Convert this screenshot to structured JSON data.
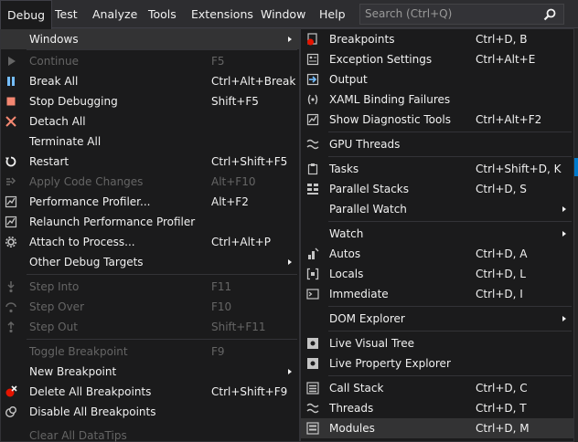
{
  "menubar": {
    "items": [
      "Debug",
      "Test",
      "Analyze",
      "Tools",
      "Extensions",
      "Window",
      "Help"
    ],
    "search_placeholder": "Search (Ctrl+Q)"
  },
  "debug_menu": {
    "items": [
      {
        "label": "Windows",
        "shortcut": "",
        "submenu": true,
        "disabled": false
      },
      {
        "label": "Continue",
        "shortcut": "F5",
        "disabled": true
      },
      {
        "label": "Break All",
        "shortcut": "Ctrl+Alt+Break",
        "disabled": false
      },
      {
        "label": "Stop Debugging",
        "shortcut": "Shift+F5",
        "disabled": false
      },
      {
        "label": "Detach All",
        "shortcut": "",
        "disabled": false
      },
      {
        "label": "Terminate All",
        "shortcut": "",
        "disabled": false
      },
      {
        "label": "Restart",
        "shortcut": "Ctrl+Shift+F5",
        "disabled": false
      },
      {
        "label": "Apply Code Changes",
        "shortcut": "Alt+F10",
        "disabled": true
      },
      {
        "label": "Performance Profiler...",
        "shortcut": "Alt+F2",
        "disabled": false
      },
      {
        "label": "Relaunch Performance Profiler",
        "shortcut": "",
        "disabled": false
      },
      {
        "label": "Attach to Process...",
        "shortcut": "Ctrl+Alt+P",
        "disabled": false
      },
      {
        "label": "Other Debug Targets",
        "shortcut": "",
        "submenu": true,
        "disabled": false
      },
      {
        "label": "Step Into",
        "shortcut": "F11",
        "disabled": true
      },
      {
        "label": "Step Over",
        "shortcut": "F10",
        "disabled": true
      },
      {
        "label": "Step Out",
        "shortcut": "Shift+F11",
        "disabled": true
      },
      {
        "label": "Toggle Breakpoint",
        "shortcut": "F9",
        "disabled": true
      },
      {
        "label": "New Breakpoint",
        "shortcut": "",
        "submenu": true,
        "disabled": false
      },
      {
        "label": "Delete All Breakpoints",
        "shortcut": "Ctrl+Shift+F9",
        "disabled": false
      },
      {
        "label": "Disable All Breakpoints",
        "shortcut": "",
        "disabled": false
      },
      {
        "label": "Clear All DataTips",
        "shortcut": "",
        "disabled": true
      }
    ]
  },
  "windows_submenu": {
    "items": [
      {
        "label": "Breakpoints",
        "shortcut": "Ctrl+D, B"
      },
      {
        "label": "Exception Settings",
        "shortcut": "Ctrl+Alt+E"
      },
      {
        "label": "Output",
        "shortcut": ""
      },
      {
        "label": "XAML Binding Failures",
        "shortcut": ""
      },
      {
        "label": "Show Diagnostic Tools",
        "shortcut": "Ctrl+Alt+F2"
      },
      {
        "label": "GPU Threads",
        "shortcut": ""
      },
      {
        "label": "Tasks",
        "shortcut": "Ctrl+Shift+D, K"
      },
      {
        "label": "Parallel Stacks",
        "shortcut": "Ctrl+D, S"
      },
      {
        "label": "Parallel Watch",
        "shortcut": "",
        "submenu": true
      },
      {
        "label": "Watch",
        "shortcut": "",
        "submenu": true
      },
      {
        "label": "Autos",
        "shortcut": "Ctrl+D, A"
      },
      {
        "label": "Locals",
        "shortcut": "Ctrl+D, L"
      },
      {
        "label": "Immediate",
        "shortcut": "Ctrl+D, I"
      },
      {
        "label": "DOM Explorer",
        "shortcut": "",
        "submenu": true
      },
      {
        "label": "Live Visual Tree",
        "shortcut": ""
      },
      {
        "label": "Live Property Explorer",
        "shortcut": ""
      },
      {
        "label": "Call Stack",
        "shortcut": "Ctrl+D, C"
      },
      {
        "label": "Threads",
        "shortcut": "Ctrl+D, T"
      },
      {
        "label": "Modules",
        "shortcut": "Ctrl+D, M"
      }
    ]
  },
  "colors": {
    "menubar_bg": "#2d2d30",
    "menu_bg": "#1b1b1c",
    "highlight": "#333334",
    "accent": "#007acc",
    "stop_red": "#f48771",
    "pause_blue": "#75beff"
  }
}
